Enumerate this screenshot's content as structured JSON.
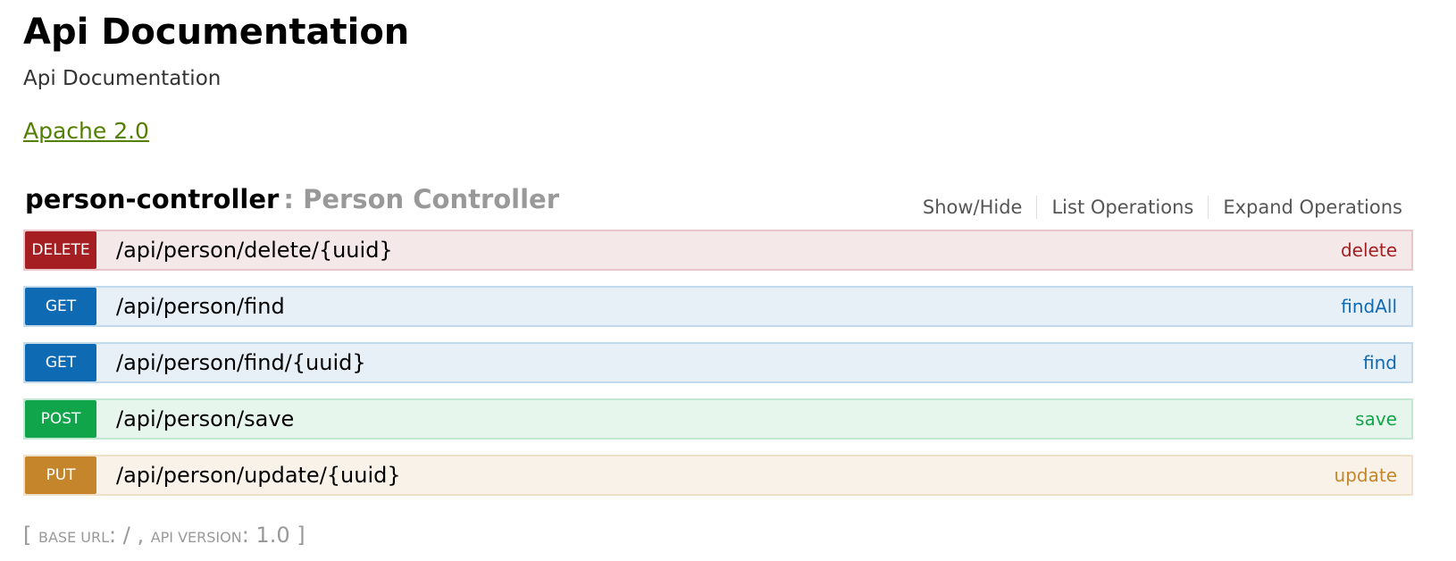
{
  "info": {
    "title": "Api Documentation",
    "description": "Api Documentation",
    "license": "Apache 2.0"
  },
  "resource": {
    "name": "person-controller",
    "description": ": Person Controller",
    "options": [
      "Show/Hide",
      "List Operations",
      "Expand Operations"
    ]
  },
  "operations": [
    {
      "method": "DELETE",
      "path": "/api/person/delete/{uuid}",
      "nickname": "delete"
    },
    {
      "method": "GET",
      "path": "/api/person/find",
      "nickname": "findAll"
    },
    {
      "method": "GET",
      "path": "/api/person/find/{uuid}",
      "nickname": "find"
    },
    {
      "method": "POST",
      "path": "/api/person/save",
      "nickname": "save"
    },
    {
      "method": "PUT",
      "path": "/api/person/update/{uuid}",
      "nickname": "update"
    }
  ],
  "footer": {
    "open": "[ ",
    "base_url_label": "base url",
    "base_url_value": ": / , ",
    "api_version_label": "api version",
    "api_version_value": ": 1.0 ]"
  },
  "colors": {
    "delete": "#a41e22",
    "get": "#0f6ab4",
    "post": "#10a54a",
    "put": "#c5862b",
    "license_link": "#547f00"
  }
}
